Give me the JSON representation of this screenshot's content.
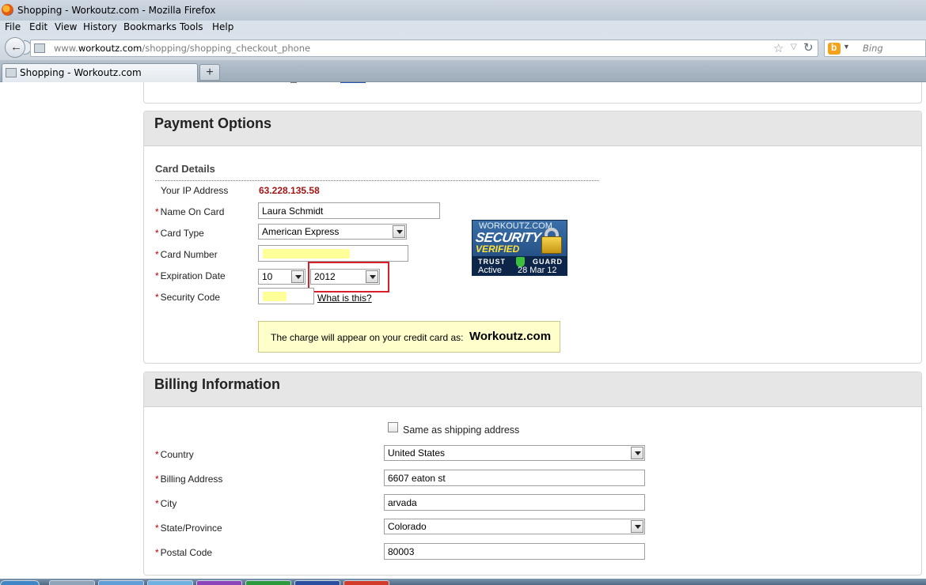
{
  "window": {
    "title": "Shopping - Workoutz.com - Mozilla Firefox"
  },
  "menu": [
    "File",
    "Edit",
    "View",
    "History",
    "Bookmarks",
    "Tools",
    "Help"
  ],
  "nav": {
    "url_prefix": "www.",
    "url_domain": "workoutz.com",
    "url_path": "/shopping/shopping_checkout_phone",
    "search_placeholder": "Bing"
  },
  "tab": {
    "label": "Shopping - Workoutz.com",
    "new_tab": "+"
  },
  "payment": {
    "heading": "Payment Options",
    "section": "Card Details",
    "ip_label": "Your IP Address",
    "ip_value": "63.228.135.58",
    "name_label": "Name On Card",
    "name_value": "Laura Schmidt",
    "type_label": "Card Type",
    "type_value": "American Express",
    "number_label": "Card Number",
    "number_value": "",
    "exp_label": "Expiration Date",
    "exp_month": "10",
    "exp_year": "2012",
    "cvv_label": "Security Code",
    "cvv_value": "",
    "cvv_link": "What is this?",
    "notice_text": "The charge will appear on your credit card as:",
    "notice_brand": "Workoutz.com",
    "required_mark": "*"
  },
  "badge": {
    "site": "WORKOUTZ.COM",
    "security": "SECURITY",
    "verified": "VERIFIED",
    "trust": "TRUST",
    "guard": "GUARD",
    "status": "Active",
    "date": "28 Mar 12",
    "icon": "padlock-icon"
  },
  "billing": {
    "heading": "Billing Information",
    "same_label": "Same as shipping address",
    "same_checked": false,
    "country_label": "Country",
    "country_value": "United States",
    "address_label": "Billing Address",
    "address_value": "6607 eaton st",
    "city_label": "City",
    "city_value": "arvada",
    "state_label": "State/Province",
    "state_value": "Colorado",
    "postal_label": "Postal Code",
    "postal_value": "80003"
  },
  "colors": {
    "required": "#c00000",
    "ip": "#a31515",
    "highlight": "#ffff99",
    "notice_bg": "#ffffcc",
    "annotation": "#d9202a"
  }
}
